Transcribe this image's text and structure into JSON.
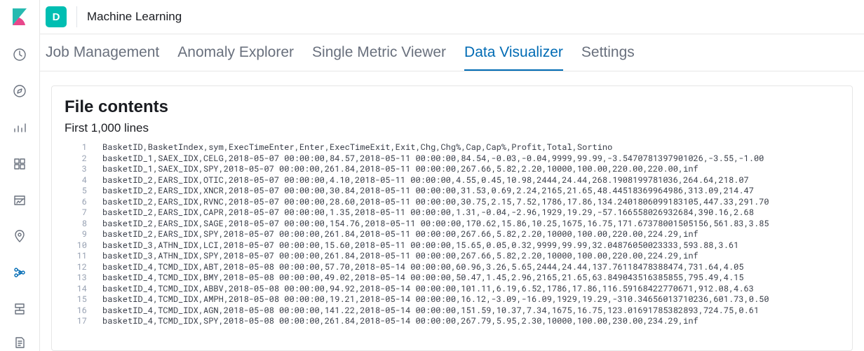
{
  "header": {
    "space_letter": "D",
    "app_title": "Machine Learning"
  },
  "tabs": [
    {
      "label": "Job Management",
      "active": false
    },
    {
      "label": "Anomaly Explorer",
      "active": false
    },
    {
      "label": "Single Metric Viewer",
      "active": false
    },
    {
      "label": "Data Visualizer",
      "active": true
    },
    {
      "label": "Settings",
      "active": false
    }
  ],
  "panel": {
    "title": "File contents",
    "subtitle": "First 1,000 lines"
  },
  "file_lines": [
    "BasketID,BasketIndex,sym,ExecTimeEnter,Enter,ExecTimeExit,Exit,Chg,Chg%,Cap,Cap%,Profit,Total,Sortino",
    "basketID_1,SAEX_IDX,CELG,2018-05-07 00:00:00,84.57,2018-05-11 00:00:00,84.54,-0.03,-0.04,9999,99.99,-3.5470781397901026,-3.55,-1.00",
    "basketID_1,SAEX_IDX,SPY,2018-05-07 00:00:00,261.84,2018-05-11 00:00:00,267.66,5.82,2.20,10000,100.00,220.00,220.00,inf",
    "basketID_2,EARS_IDX,OTIC,2018-05-07 00:00:00,4.10,2018-05-11 00:00:00,4.55,0.45,10.98,2444,24.44,268.1908199781036,264.64,218.07",
    "basketID_2,EARS_IDX,XNCR,2018-05-07 00:00:00,30.84,2018-05-11 00:00:00,31.53,0.69,2.24,2165,21.65,48.44518369964986,313.09,214.47",
    "basketID_2,EARS_IDX,RVNC,2018-05-07 00:00:00,28.60,2018-05-11 00:00:00,30.75,2.15,7.52,1786,17.86,134.2401806099183105,447.33,291.70",
    "basketID_2,EARS_IDX,CAPR,2018-05-07 00:00:00,1.35,2018-05-11 00:00:00,1.31,-0.04,-2.96,1929,19.29,-57.166558026932684,390.16,2.68",
    "basketID_2,EARS_IDX,SAGE,2018-05-07 00:00:00,154.76,2018-05-11 00:00:00,170.62,15.86,10.25,1675,16.75,171.67378001505156,561.83,3.85",
    "basketID_2,EARS_IDX,SPY,2018-05-07 00:00:00,261.84,2018-05-11 00:00:00,267.66,5.82,2.20,10000,100.00,220.00,224.29,inf",
    "basketID_3,ATHN_IDX,LCI,2018-05-07 00:00:00,15.60,2018-05-11 00:00:00,15.65,0.05,0.32,9999,99.99,32.04876050023333,593.88,3.61",
    "basketID_3,ATHN_IDX,SPY,2018-05-07 00:00:00,261.84,2018-05-11 00:00:00,267.66,5.82,2.20,10000,100.00,220.00,224.29,inf",
    "basketID_4,TCMD_IDX,ABT,2018-05-08 00:00:00,57.70,2018-05-14 00:00:00,60.96,3.26,5.65,2444,24.44,137.76118478388474,731.64,4.05",
    "basketID_4,TCMD_IDX,BMY,2018-05-08 00:00:00,49.02,2018-05-14 00:00:00,50.47,1.45,2.96,2165,21.65,63.849043516385855,795.49,4.15",
    "basketID_4,TCMD_IDX,ABBV,2018-05-08 00:00:00,94.92,2018-05-14 00:00:00,101.11,6.19,6.52,1786,17.86,116.59168422770671,912.08,4.63",
    "basketID_4,TCMD_IDX,AMPH,2018-05-08 00:00:00,19.21,2018-05-14 00:00:00,16.12,-3.09,-16.09,1929,19.29,-310.34656013710236,601.73,0.50",
    "basketID_4,TCMD_IDX,AGN,2018-05-08 00:00:00,141.22,2018-05-14 00:00:00,151.59,10.37,7.34,1675,16.75,123.01691785382893,724.75,0.61",
    "basketID_4,TCMD_IDX,SPY,2018-05-08 00:00:00,261.84,2018-05-14 00:00:00,267.79,5.95,2.30,10000,100.00,230.00,234.29,inf"
  ]
}
